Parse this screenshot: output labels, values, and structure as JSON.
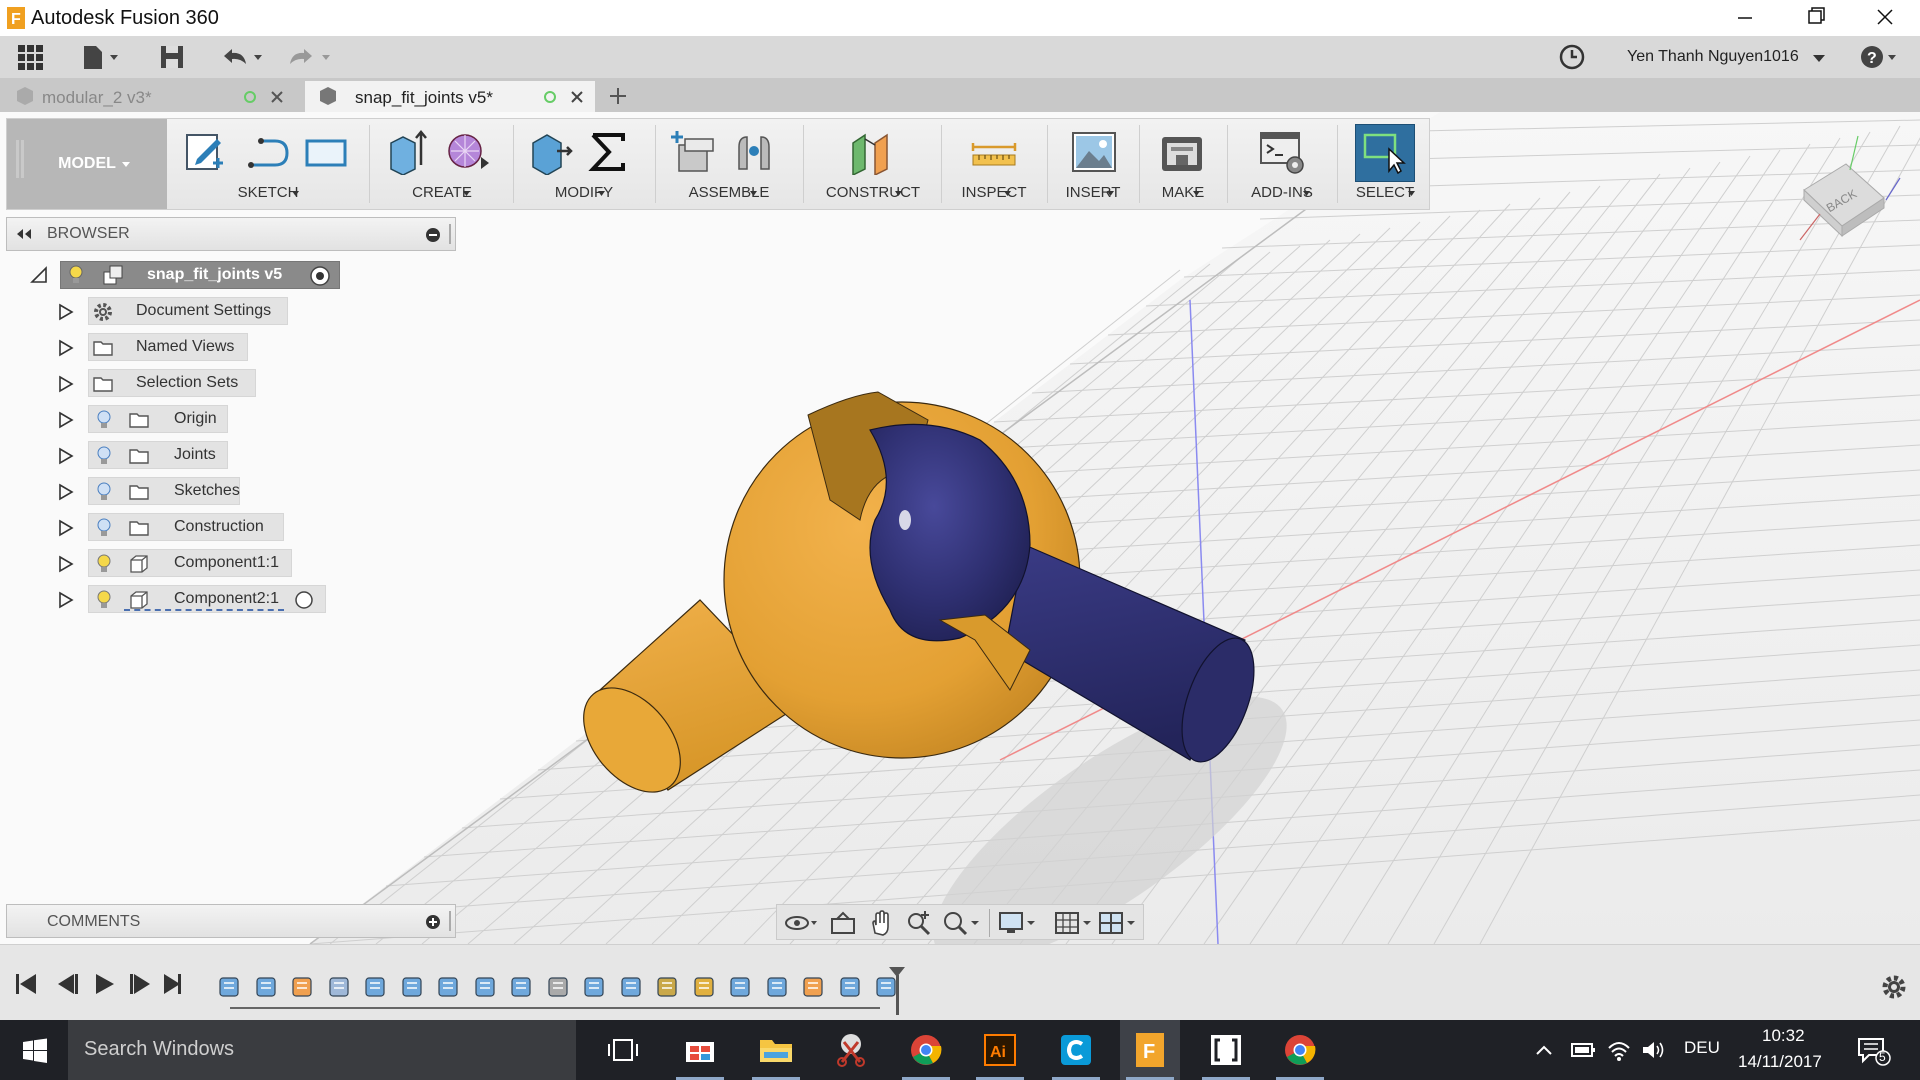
{
  "window": {
    "title": "Autodesk Fusion 360"
  },
  "qat": {
    "user_name": "Yen Thanh Nguyen1016"
  },
  "tabs": [
    {
      "label": "modular_2 v3*",
      "active": false
    },
    {
      "label": "snap_fit_joints v5*",
      "active": true
    }
  ],
  "ribbon": {
    "workspace": "MODEL",
    "groups": {
      "sketch": "SKETCH",
      "create": "CREATE",
      "modify": "MODIFY",
      "assemble": "ASSEMBLE",
      "construct": "CONSTRUCT",
      "inspect": "INSPECT",
      "insert": "INSERT",
      "make": "MAKE",
      "addins": "ADD-INS",
      "select": "SELECT"
    }
  },
  "browser": {
    "header": "BROWSER",
    "root": "snap_fit_joints v5",
    "items": [
      {
        "label": "Document Settings"
      },
      {
        "label": "Named Views"
      },
      {
        "label": "Selection Sets"
      },
      {
        "label": "Origin"
      },
      {
        "label": "Joints"
      },
      {
        "label": "Sketches"
      },
      {
        "label": "Construction"
      },
      {
        "label": "Component1:1"
      },
      {
        "label": "Component2:1"
      }
    ]
  },
  "viewcube": {
    "face": "BACK"
  },
  "comments": {
    "header": "COMMENTS"
  },
  "taskbar": {
    "search_placeholder": "Search Windows",
    "language": "DEU",
    "time": "10:32",
    "date": "14/11/2017",
    "notifications": "5"
  },
  "colors": {
    "orange_part": "#e8a838",
    "blue_part": "#2e2f6e",
    "accent_select": "#2f6f9f"
  }
}
